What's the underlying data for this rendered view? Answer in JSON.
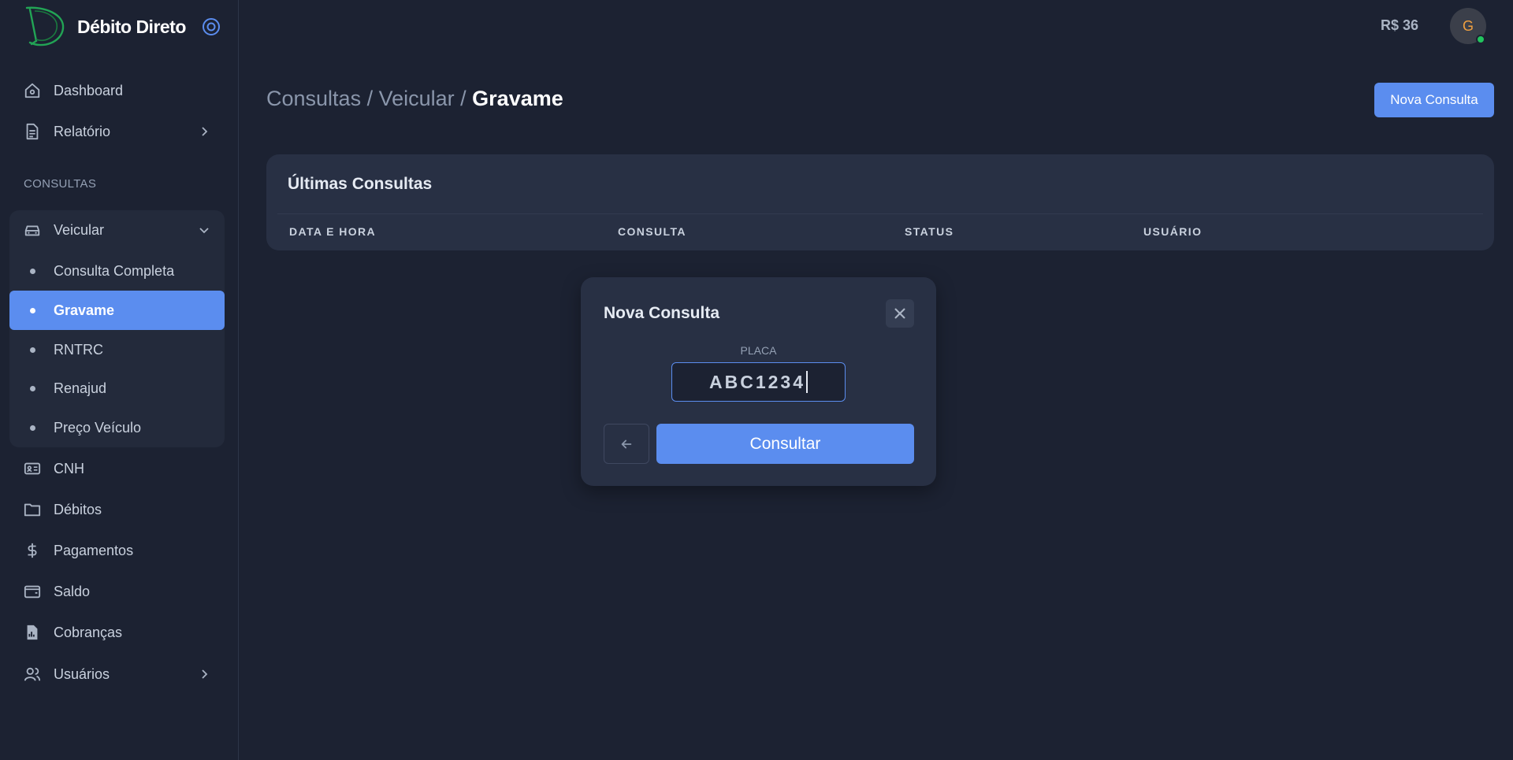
{
  "app": {
    "name": "Débito Direto"
  },
  "sidebar": {
    "items_top": [
      {
        "label": "Dashboard",
        "icon": "home-icon"
      },
      {
        "label": "Relatório",
        "icon": "document-icon"
      }
    ],
    "section_label": "CONSULTAS",
    "group": {
      "label": "Veicular",
      "icon": "car-icon",
      "children": [
        {
          "label": "Consulta Completa"
        },
        {
          "label": "Gravame"
        },
        {
          "label": "RNTRC"
        },
        {
          "label": "Renajud"
        },
        {
          "label": "Preço Veículo"
        }
      ]
    },
    "items_bottom": [
      {
        "label": "CNH",
        "icon": "id-card-icon"
      },
      {
        "label": "Débitos",
        "icon": "folder-icon"
      },
      {
        "label": "Pagamentos",
        "icon": "dollar-icon"
      },
      {
        "label": "Saldo",
        "icon": "wallet-icon"
      },
      {
        "label": "Cobranças",
        "icon": "invoice-icon"
      },
      {
        "label": "Usuários",
        "icon": "users-icon"
      }
    ]
  },
  "header": {
    "balance": "R$ 36",
    "avatar_initial": "G"
  },
  "breadcrumb": {
    "part1": "Consultas",
    "sep": " / ",
    "part2": "Veicular",
    "current": "Gravame"
  },
  "actions": {
    "new_query_label": "Nova Consulta"
  },
  "card": {
    "title": "Últimas Consultas",
    "columns": [
      "DATA E HORA",
      "CONSULTA",
      "STATUS",
      "USUÁRIO"
    ]
  },
  "modal": {
    "title": "Nova Consulta",
    "field_label": "PLACA",
    "plate_value": "ABC1234",
    "submit_label": "Consultar"
  },
  "colors": {
    "accent": "#5b8def",
    "background": "#1c2232",
    "card": "#283044",
    "logo": "#22a455",
    "online": "#22c55e"
  }
}
